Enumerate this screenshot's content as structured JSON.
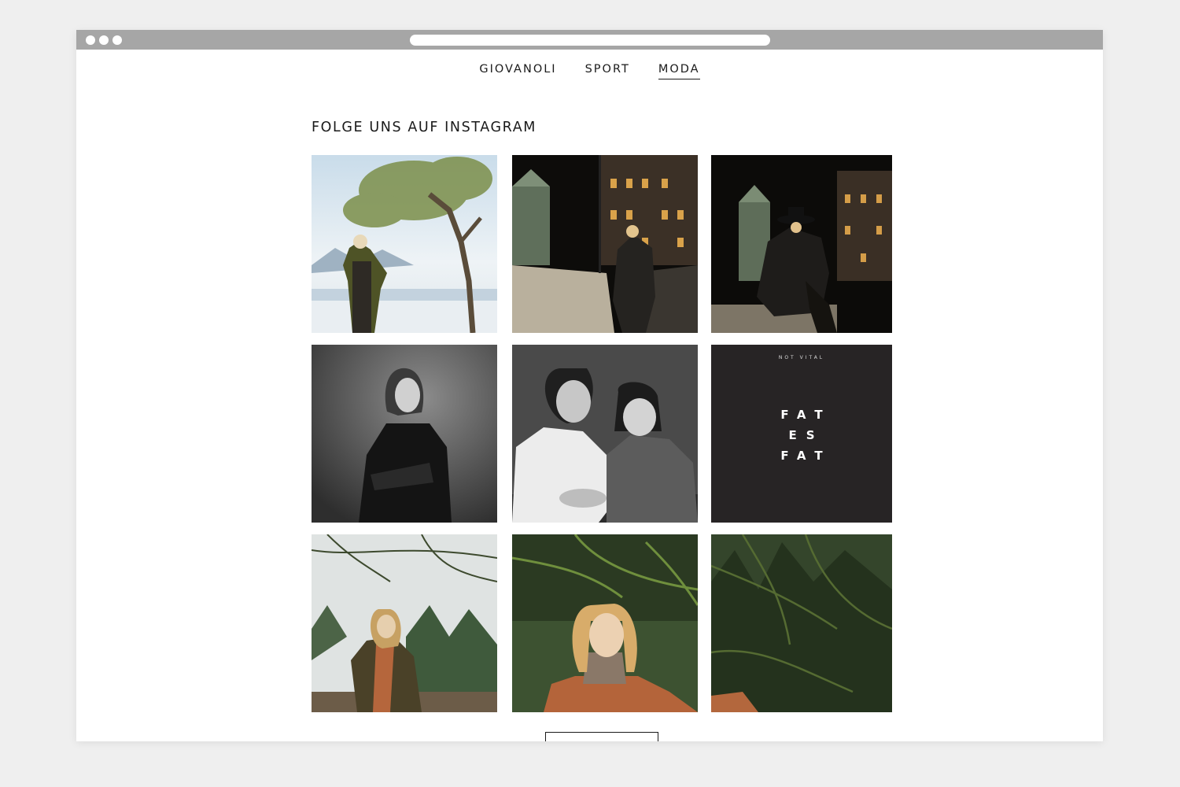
{
  "nav": {
    "items": [
      "GIOVANOLI",
      "SPORT",
      "MODA"
    ],
    "active": "MODA"
  },
  "instagram": {
    "title": "FOLGE UNS AUF INSTAGRAM",
    "tiles": [
      {
        "description": "woman-in-olive-parka-under-tree-by-lake"
      },
      {
        "description": "woman-in-black-knit-at-night-street"
      },
      {
        "description": "woman-in-hat-and-puffer-at-night"
      },
      {
        "description": "bw-portrait-girl-arms-crossed"
      },
      {
        "description": "bw-portrait-man-and-girl"
      },
      {
        "description": "fat-es-fat-graphic"
      },
      {
        "description": "woman-in-plaid-coat-among-larches"
      },
      {
        "description": "closeup-woman-plaid-coat-forest"
      },
      {
        "description": "forest-larch-branches"
      }
    ],
    "fat_graphic": {
      "top_text": "NOT VITAL",
      "line1": "FAT",
      "line2": "ES",
      "line3": "FAT"
    }
  },
  "colors": {
    "page_bg": "#efefef",
    "titlebar": "#a6a6a6",
    "text": "#1a1a1a",
    "fat_bg": "#272425"
  }
}
